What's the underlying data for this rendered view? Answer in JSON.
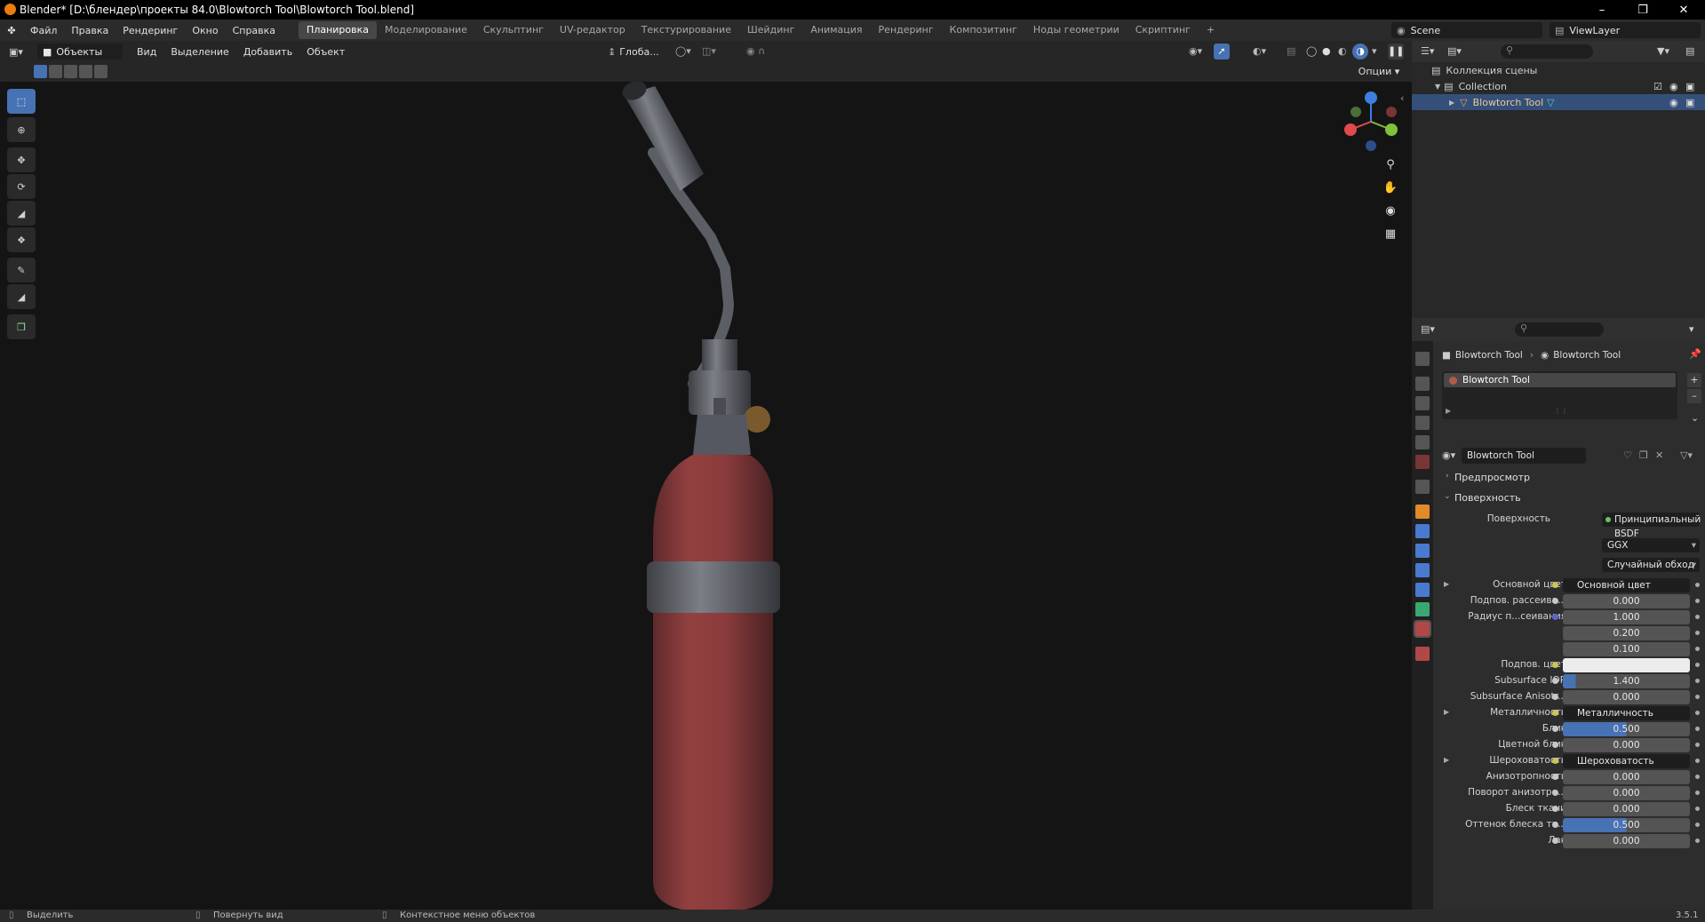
{
  "titlebar": {
    "title": "Blender* [D:\\блендер\\проекты 84.0\\Blowtorch Tool\\Blowtorch Tool.blend]"
  },
  "menu": [
    "Файл",
    "Правка",
    "Рендеринг",
    "Окно",
    "Справка"
  ],
  "workspaces": [
    "Планировка",
    "Моделирование",
    "Скульптинг",
    "UV-редактор",
    "Текстурирование",
    "Шейдинг",
    "Анимация",
    "Рендеринг",
    "Композитинг",
    "Ноды геометрии",
    "Скриптинг"
  ],
  "workspace_add": "+",
  "scene": {
    "label": "Scene",
    "viewlayer": "ViewLayer"
  },
  "viewport_header": {
    "mode": "Объекты",
    "menus": [
      "Вид",
      "Выделение",
      "Добавить",
      "Объект"
    ],
    "transform_orientation": "Глоба...",
    "options": "Опции"
  },
  "outliner": {
    "scene_collection": "Коллекция сцены",
    "collection": "Collection",
    "object": "Blowtorch Tool"
  },
  "properties": {
    "breadcrumb_object": "Blowtorch Tool",
    "breadcrumb_material": "Blowtorch Tool",
    "slot_name": "Blowtorch Tool",
    "material_name": "Blowtorch Tool",
    "preview_label": "Предпросмотр",
    "surface_section": "Поверхность",
    "surface_label": "Поверхность",
    "surface_value": "Принципиальный BSDF",
    "distribution": "GGX",
    "subsurface_method": "Случайный обход",
    "rows": [
      {
        "label": "Основной цвет",
        "value": "Основной цвет",
        "link": true
      },
      {
        "label": "Подпов. рассеива...",
        "value": "0.000"
      },
      {
        "label": "Радиус п...сеивания",
        "value": "1.000"
      },
      {
        "label": "",
        "value": "0.200"
      },
      {
        "label": "",
        "value": "0.100"
      },
      {
        "label": "Подпов. цвет",
        "value": "",
        "color": "#ececec"
      },
      {
        "label": "Subsurface IOR",
        "value": "1.400",
        "fill": 0.1
      },
      {
        "label": "Subsurface Anisotr...",
        "value": "0.000"
      },
      {
        "label": "Металличность",
        "value": "Металличность",
        "link": true
      },
      {
        "label": "Блик",
        "value": "0.500",
        "fill": 0.5
      },
      {
        "label": "Цветной блик",
        "value": "0.000"
      },
      {
        "label": "Шероховатость",
        "value": "Шероховатость",
        "link": true
      },
      {
        "label": "Анизотропность",
        "value": "0.000"
      },
      {
        "label": "Поворот анизотро...",
        "value": "0.000"
      },
      {
        "label": "Блеск ткани",
        "value": "0.000"
      },
      {
        "label": "Оттенок блеска тк...",
        "value": "0.500",
        "fill": 0.5
      },
      {
        "label": "Лак",
        "value": "0.000"
      }
    ]
  },
  "statusbar": {
    "select": "Выделить",
    "rotate": "Повернуть вид",
    "context": "Контекстное меню объектов",
    "version": "3.5.1"
  },
  "colors": {
    "accent": "#4772b3",
    "canister": "#8e3c3e",
    "viewport_bg": "#141414"
  }
}
